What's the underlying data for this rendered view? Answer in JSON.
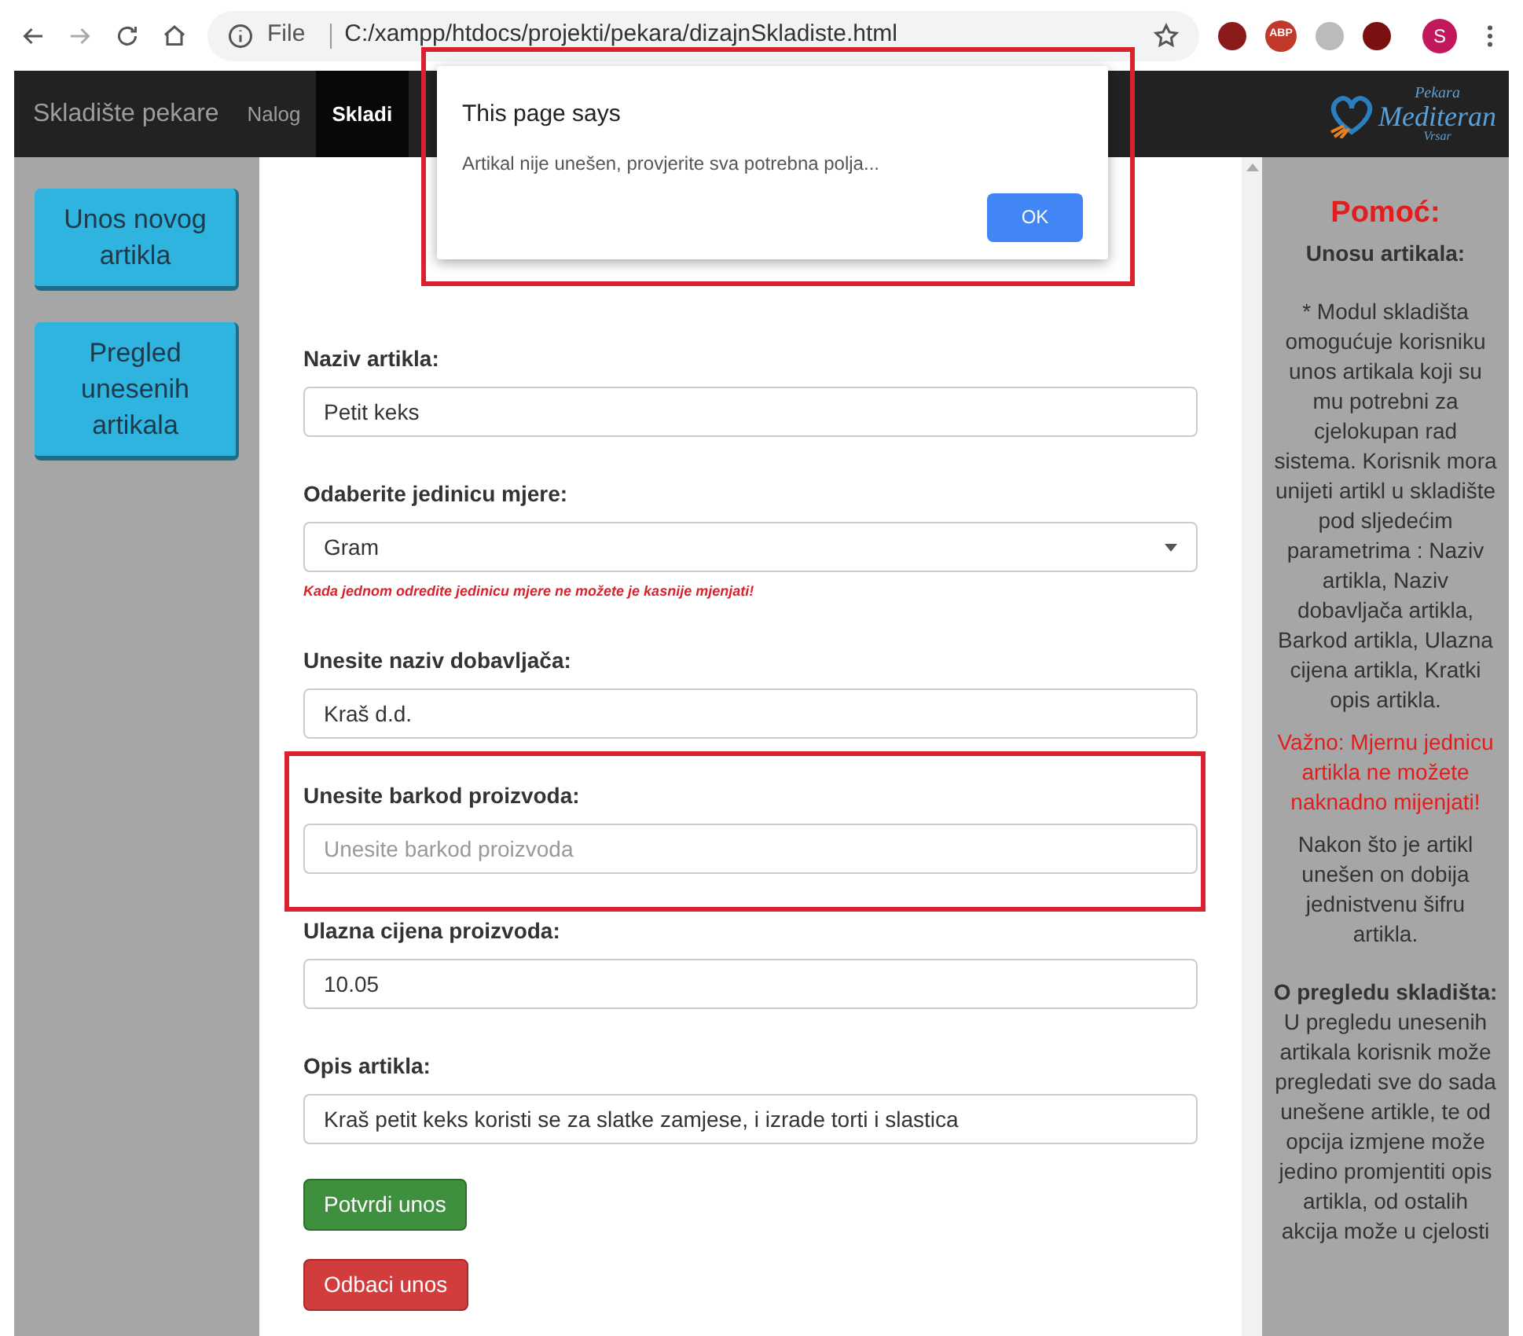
{
  "browser": {
    "scheme": "File",
    "url": "C:/xampp/htdocs/projekti/pekara/dizajnSkladiste.html",
    "extensions": [
      {
        "label": "ABP",
        "color": "#c0392b"
      }
    ],
    "profile": "S"
  },
  "navbar": {
    "brand": "Skladište pekare",
    "items": [
      {
        "label": "Nalog",
        "selected": false
      },
      {
        "label": "Skladi",
        "selected": true
      }
    ],
    "logo": {
      "top": "Pekara",
      "main": "Mediteran",
      "bottom": "Vrsar"
    }
  },
  "sidebar": {
    "buttons": [
      "Unos novog artikla",
      "Pregled unesenih artikala"
    ]
  },
  "form": {
    "fields": [
      {
        "kind": "input",
        "label": "Naziv artikla:",
        "value": "Petit keks",
        "highlighted": false
      },
      {
        "kind": "select",
        "label": "Odaberite jedinicu mjere:",
        "value": "Gram",
        "hint": "Kada jednom odredite jedinicu mjere ne možete je kasnije mjenjati!",
        "highlighted": false
      },
      {
        "kind": "input",
        "label": "Unesite naziv dobavljača:",
        "value": "Kraš d.d.",
        "highlighted": false
      },
      {
        "kind": "input",
        "label": "Unesite barkod proizvoda:",
        "placeholder": "Unesite barkod proizvoda",
        "highlighted": true
      },
      {
        "kind": "input",
        "label": "Ulazna cijena proizvoda:",
        "value": "10.05",
        "highlighted": false
      },
      {
        "kind": "input",
        "label": "Opis artikla:",
        "value": "Kraš petit keks koristi se za slatke zamjese, i izrade torti i slastica",
        "highlighted": false
      }
    ],
    "buttons": [
      {
        "label": "Potvrdi unos",
        "kind": "success"
      },
      {
        "label": "Odbaci unos",
        "kind": "danger"
      }
    ]
  },
  "help": {
    "title": "Pomoć:",
    "blocks": [
      {
        "kind": "heading",
        "text": "Unosu artikala:"
      },
      {
        "kind": "text",
        "text": "* Modul skladišta omogućuje korisniku unos artikala koji su mu potrebni za cjelokupan rad sistema. Korisnik mora unijeti artikl u skladište pod sljedećim parametrima : Naziv artikla, Naziv dobavljača artikla, Barkod artikla, Ulazna cijena artikla, Kratki opis artikla."
      },
      {
        "kind": "warning",
        "text": "Važno: Mjernu jednicu artikla ne možete naknadno mijenjati!"
      },
      {
        "kind": "text",
        "text": "Nakon što je artikl unešen on dobija jednistvenu šifru artikla."
      },
      {
        "kind": "heading",
        "text": "O pregledu skladišta:"
      },
      {
        "kind": "text",
        "text": "U pregledu unesenih artikala korisnik može pregledati sve do sada unešene artikle, te od opcija izmjene može jedino promjentiti opis artikla, od ostalih akcija može u cjelosti"
      }
    ]
  },
  "dialog": {
    "title": "This page says",
    "message": "Artikal nije unešen, provjerite sva potrebna polja...",
    "button": "OK",
    "highlighted": true
  }
}
